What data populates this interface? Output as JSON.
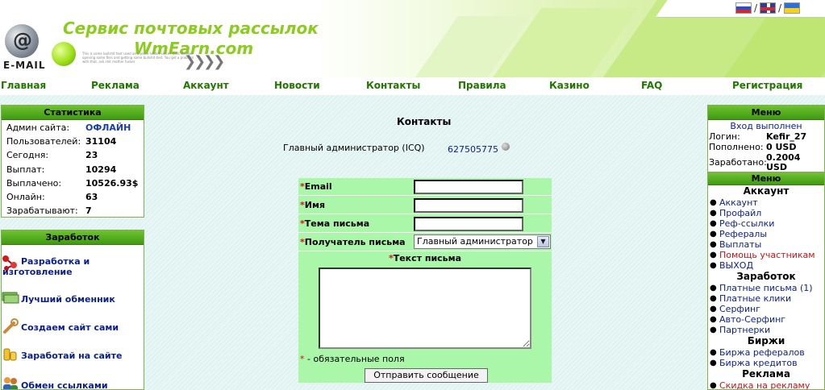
{
  "header": {
    "logo_text": "E-MAIL",
    "title_line1": "Сервис почтовых рассылок",
    "title_line2": "WmEarn.com",
    "tiny_text": "This is some bullshit text used as a place holder since I dont feel like opening some files and getting some bullshit text. You get a problem with that, ask shit mother fucker",
    "languages": [
      "ru-flag",
      "uk-flag",
      "ua-flag"
    ],
    "separator": "/"
  },
  "nav": {
    "items": [
      "Главная",
      "Реклама",
      "Аккаунт",
      "Новости",
      "Контакты",
      "Правила",
      "Казино",
      "FAQ",
      "Регистрация"
    ]
  },
  "stats": {
    "title": "Статистика",
    "rows": [
      {
        "label": "Админ сайта:",
        "value": "ОФЛАЙН"
      },
      {
        "label": "Пользователей:",
        "value": "31104"
      },
      {
        "label": "Сегодня:",
        "value": "23"
      },
      {
        "label": "Выплат:",
        "value": "10294"
      },
      {
        "label": "Выплачено:",
        "value": "10526.93$"
      },
      {
        "label": "Онлайн:",
        "value": "63"
      },
      {
        "label": "Зарабатывают:",
        "value": "7"
      }
    ]
  },
  "earn": {
    "title": "Заработок",
    "items": [
      {
        "label_line1": "Разработка и",
        "label_line2": "изготовление",
        "icon": "molecule-icon"
      },
      {
        "label_line1": "Лучший обменник",
        "label_line2": "",
        "icon": "money-icon"
      },
      {
        "label_line1": "Создаем сайт сами",
        "label_line2": "",
        "icon": "wrench-icon"
      },
      {
        "label_line1": "Заработай на сайте",
        "label_line2": "",
        "icon": "coins-icon"
      },
      {
        "label_line1": "Обмен ссылками",
        "label_line2": "",
        "icon": "people-icon"
      }
    ]
  },
  "contacts": {
    "title": "Контакты",
    "admin_label": "Главный администратор (ICQ)",
    "admin_icq": "627505775"
  },
  "form": {
    "required_mark": "*",
    "fields": [
      {
        "label": "Email",
        "value": ""
      },
      {
        "label": "Имя",
        "value": ""
      },
      {
        "label": "Тема письма",
        "value": ""
      }
    ],
    "recipient_label": "Получатель письма",
    "recipient_value": "Главный администратор",
    "text_label": "Текст письма",
    "message_value": "",
    "required_note": " - обязательные поля",
    "submit_label": "Отправить сообщение"
  },
  "account": {
    "title": "Меню",
    "status": "Вход выполнен",
    "rows": [
      {
        "label": "Логин:",
        "value": "Kefir_27"
      },
      {
        "label": "Пополнено:",
        "value": "0 USD"
      },
      {
        "label": "Заработано:",
        "value": "0.2004 USD"
      }
    ]
  },
  "menu": {
    "title": "Меню",
    "sections": [
      {
        "title": "Аккаунт",
        "items": [
          {
            "label": "Аккаунт",
            "red": false
          },
          {
            "label": "Профайл",
            "red": false
          },
          {
            "label": "Реф-ссылки",
            "red": false
          },
          {
            "label": "Рефералы",
            "red": false
          },
          {
            "label": "Выплаты",
            "red": false
          },
          {
            "label": "Помощь участникам",
            "red": true
          },
          {
            "label": "ВЫХОД",
            "red": false
          }
        ]
      },
      {
        "title": "Заработок",
        "items": [
          {
            "label": "Платные письма (1)",
            "red": false
          },
          {
            "label": "Платные клики",
            "red": false
          },
          {
            "label": "Серфинг",
            "red": false
          },
          {
            "label": "Авто-Серфинг",
            "red": false
          },
          {
            "label": "Партнерки",
            "red": false
          }
        ]
      },
      {
        "title": "Биржи",
        "items": [
          {
            "label": "Биржа рефералов",
            "red": false
          },
          {
            "label": "Биржа кредитов",
            "red": false
          }
        ]
      },
      {
        "title": "Реклама",
        "items": [
          {
            "label": "Скидка на рекламу",
            "red": true
          }
        ]
      }
    ]
  },
  "colors": {
    "nav_text": "#227700",
    "box_header": "#4aa818",
    "form_bg": "#aaf7aa",
    "link_blue": "#0b1f8a",
    "required_red": "#d0151b"
  }
}
